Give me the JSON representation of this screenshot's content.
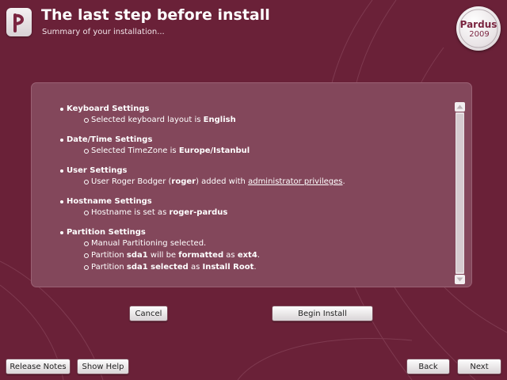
{
  "header": {
    "title": "The last step before install",
    "subtitle": "Summary of your installation...",
    "app_logo_letter": "p",
    "brand_logo": {
      "name": "Pardus",
      "year": "2009"
    }
  },
  "colors": {
    "background": "#6a2138",
    "panel": "#83475b",
    "button": "#ebe6e8"
  },
  "summary": {
    "keyboard": {
      "title": "Keyboard Settings",
      "prefix": "Selected keyboard layout is",
      "layout": "English"
    },
    "datetime": {
      "title": "Date/Time Settings",
      "prefix": "Selected TimeZone is",
      "timezone": "Europe/Istanbul"
    },
    "user": {
      "title": "User Settings",
      "prefix": "User Roger Bodger (",
      "username": "roger",
      "middle": ") added with",
      "privileges": "administrator privileges",
      "suffix": "."
    },
    "hostname": {
      "title": "Hostname Settings",
      "prefix": "Hostname is set as",
      "value": "roger-pardus"
    },
    "partition": {
      "title": "Partition Settings",
      "line1": "Manual Partitioning selected.",
      "line2": {
        "prefix": "Partition",
        "device": "sda1",
        "mid1": "will be",
        "action": "formatted",
        "mid2": "as",
        "fs": "ext4",
        "suffix": "."
      },
      "line3": {
        "prefix": "Partition",
        "device_selected": "sda1 selected",
        "mid": "as",
        "role": "Install Root",
        "suffix": "."
      }
    }
  },
  "buttons": {
    "cancel": "Cancel",
    "begin_install": "Begin Install",
    "release_notes": "Release Notes",
    "show_help": "Show Help",
    "back": "Back",
    "next": "Next"
  },
  "icons": {
    "scroll_up": "triangle-up-icon",
    "scroll_down": "triangle-down-icon"
  }
}
